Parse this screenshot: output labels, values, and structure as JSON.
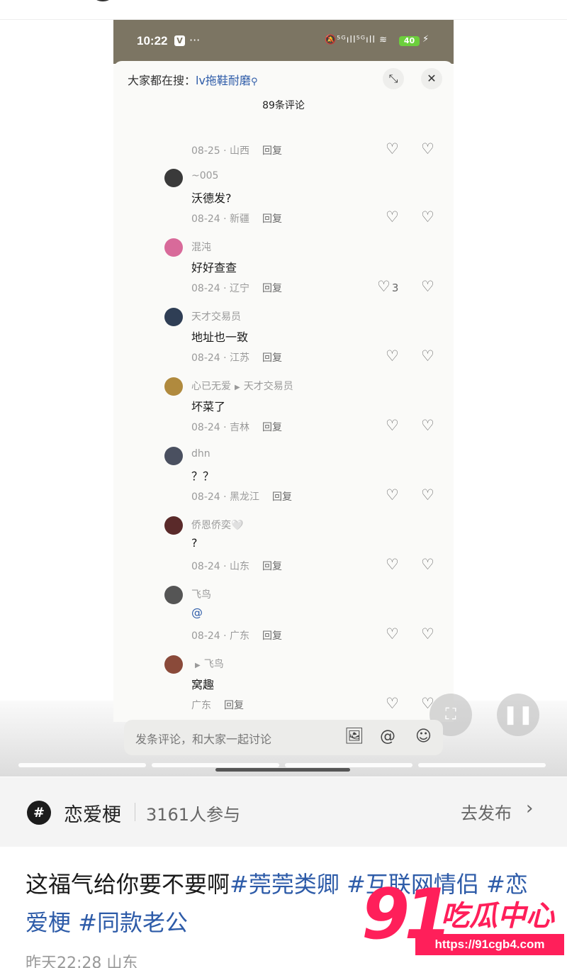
{
  "status_bar": {
    "time": "10:22",
    "app_badge": "V",
    "dots": "···",
    "icons": "🔕⁵ᴳıll⁵ᴳıll ≋",
    "battery": "40"
  },
  "comments_sheet": {
    "search_prefix": "大家都在搜：",
    "search_keyword": "lv拖鞋耐磨",
    "count_title": "89条评论",
    "reply_label": "回复",
    "top_meta": {
      "date": "08-25",
      "region": "山西"
    },
    "comments": [
      {
        "user": "~005",
        "text": "沃德发?",
        "date": "08-24",
        "region": "新疆",
        "likes": "",
        "avatar_color": "#3a3a3a"
      },
      {
        "user": "混沌",
        "text": "好好查查",
        "date": "08-24",
        "region": "辽宁",
        "likes": "3",
        "avatar_color": "#d86a9a"
      },
      {
        "user": "天才交易员",
        "text": "地址也一致",
        "date": "08-24",
        "region": "江苏",
        "likes": "",
        "avatar_color": "#2f3e55"
      },
      {
        "user": "心已无爱",
        "reply_to": "天才交易员",
        "text": "坏菜了",
        "date": "08-24",
        "region": "吉林",
        "likes": "",
        "avatar_color": "#b08a3e"
      },
      {
        "user": "dhn",
        "text": "？？",
        "date": "08-24",
        "region": "黑龙江",
        "likes": "",
        "avatar_color": "#4a5060"
      },
      {
        "user": "侨恩侨奕🤍",
        "text": "?",
        "date": "08-24",
        "region": "山东",
        "likes": "",
        "avatar_color": "#5a2a2a"
      },
      {
        "user": "飞鸟",
        "text": "@",
        "date": "08-24",
        "region": "广东",
        "likes": "",
        "avatar_color": "#555555"
      },
      {
        "user": "",
        "reply_to": "飞鸟",
        "text": "窝趣",
        "date": "",
        "region": "广东",
        "likes": "",
        "avatar_color": "#8a4a3a"
      }
    ],
    "truncated_user": "include"
  },
  "composer": {
    "placeholder": "发条评论，和大家一起讨论"
  },
  "topic": {
    "icon": "#",
    "name": "恋爱梗",
    "participants": "3161人参与",
    "publish": "去发布",
    "chevron": "›"
  },
  "post": {
    "caption_text": "这福气给你要不要啊",
    "hashtags": [
      "#莞莞类卿",
      "#互联网情侣",
      "#恋爱梗",
      "#同款老公"
    ],
    "time": "昨天22:28",
    "region": "山东"
  },
  "watermark": {
    "number": "91",
    "text": "吃瓜中心",
    "url": "https://91cgb4.com"
  },
  "colors": {
    "accent": "#2d5ba8",
    "watermark": "#ff1f5a",
    "status_bar": "#7c7563"
  }
}
